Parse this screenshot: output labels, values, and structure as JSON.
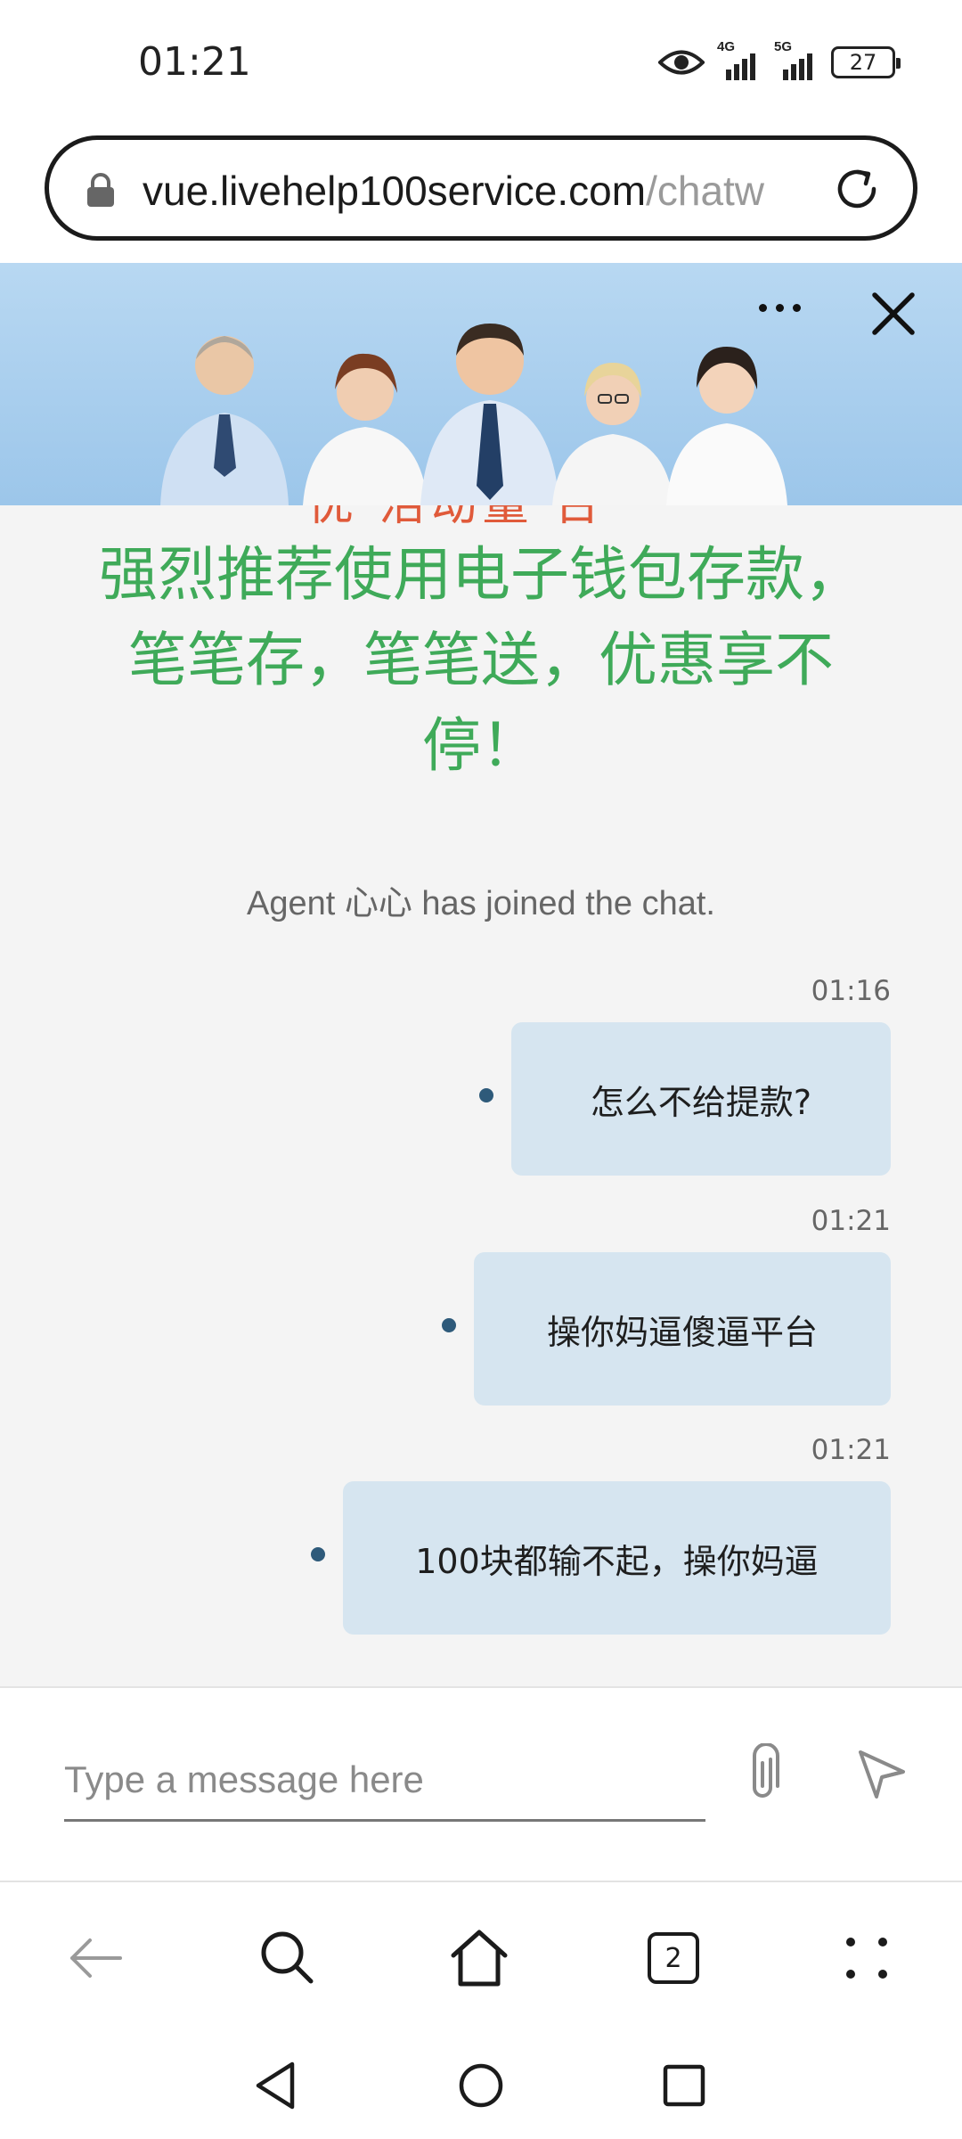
{
  "status_bar": {
    "time": "01:21",
    "signal1_label": "4G",
    "signal2_label": "5G",
    "battery": "27",
    "icons": [
      "eye-icon",
      "signal-4g-icon",
      "signal-5g-icon",
      "battery-icon"
    ]
  },
  "browser": {
    "url_host": "vue.livehelp100service.com",
    "url_path": "/chatw",
    "tab_count": "2"
  },
  "chat": {
    "header_icons": [
      "more-icon",
      "close-icon"
    ],
    "promo_cut_text": "优 活动量 台",
    "promo_text": "强烈推荐使用电子钱包存款，笔笔存，笔笔送，优惠享不停！",
    "system_note": "Agent 心心 has joined the chat.",
    "messages": [
      {
        "time": "01:16",
        "text": "怎么不给提款?"
      },
      {
        "time": "01:21",
        "text": "操你妈逼傻逼平台"
      },
      {
        "time": "01:21",
        "text": "100块都输不起，操你妈逼"
      }
    ],
    "composer_placeholder": "Type a message here"
  },
  "colors": {
    "promo_green": "#3faa59",
    "bubble_bg": "#d6e5f0",
    "header_blue": "#a8cdee"
  }
}
